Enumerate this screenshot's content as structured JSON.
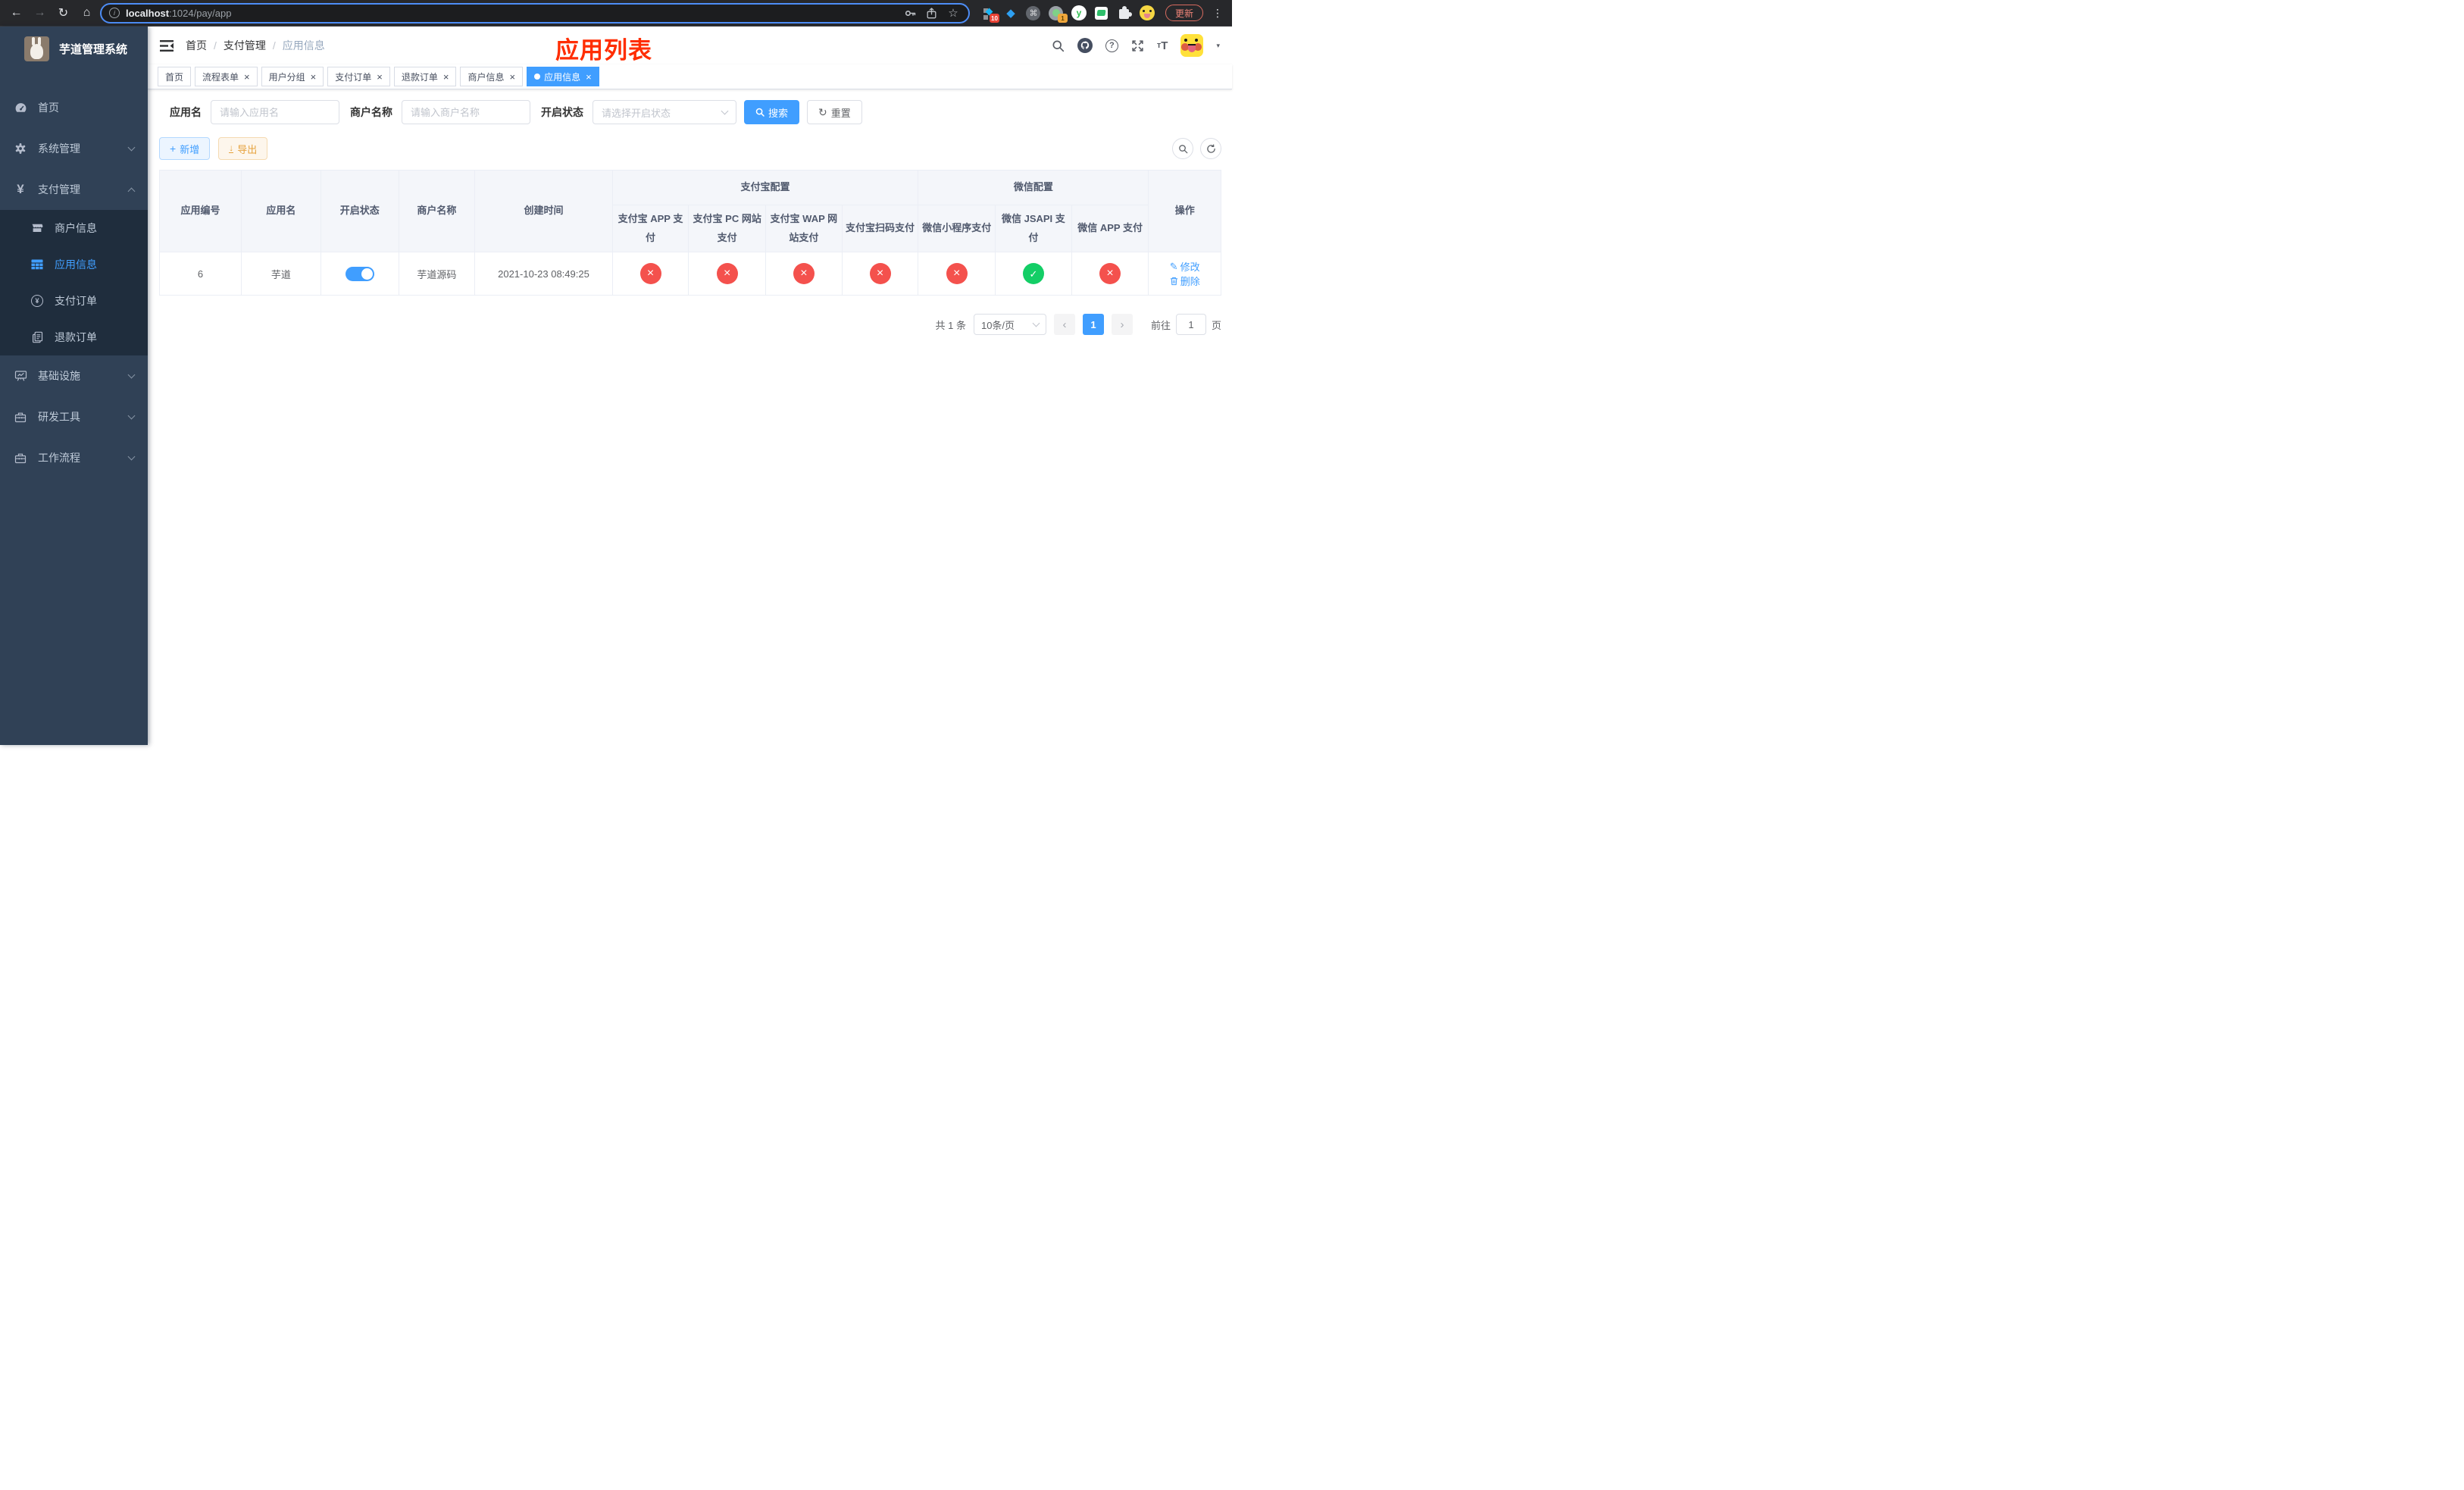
{
  "browser": {
    "url_host": "localhost",
    "url_path": ":1024/pay/app",
    "update_label": "更新",
    "ext_badge_blocks": "10",
    "ext_badge_avatar": "1"
  },
  "icons": {
    "back": "←",
    "forward": "→",
    "reload": "↻",
    "home": "⌂",
    "star": "☆",
    "dots": "⋮",
    "gem": "◆",
    "caret": "▾",
    "plus": "+",
    "download": "↓",
    "pencil": "✎",
    "prev": "‹",
    "next": "›",
    "reset": "↻"
  },
  "sidebar": {
    "title": "芋道管理系统",
    "items": {
      "home": "首页",
      "system": "系统管理",
      "pay": "支付管理",
      "merchant": "商户信息",
      "app": "应用信息",
      "pay_order": "支付订单",
      "refund_order": "退款订单",
      "infra": "基础设施",
      "dev_tools": "研发工具",
      "workflow": "工作流程"
    }
  },
  "header": {
    "breadcrumb": [
      "首页",
      "支付管理",
      "应用信息"
    ],
    "annotation": "应用列表"
  },
  "tabs": [
    {
      "label": "首页"
    },
    {
      "label": "流程表单"
    },
    {
      "label": "用户分组"
    },
    {
      "label": "支付订单"
    },
    {
      "label": "退款订单"
    },
    {
      "label": "商户信息"
    },
    {
      "label": "应用信息"
    }
  ],
  "filters": {
    "app_name_label": "应用名",
    "app_name_placeholder": "请输入应用名",
    "merchant_label": "商户名称",
    "merchant_placeholder": "请输入商户名称",
    "status_label": "开启状态",
    "status_placeholder": "请选择开启状态",
    "search_label": "搜索",
    "reset_label": "重置"
  },
  "toolbar": {
    "add_label": "新增",
    "export_label": "导出"
  },
  "table": {
    "group_alipay": "支付宝配置",
    "group_wechat": "微信配置",
    "columns": {
      "id": "应用编号",
      "name": "应用名",
      "status": "开启状态",
      "merchant": "商户名称",
      "created": "创建时间",
      "alipay_app": "支付宝 APP 支付",
      "alipay_pc": "支付宝 PC 网站支付",
      "alipay_wap": "支付宝 WAP 网站支付",
      "alipay_qr": "支付宝扫码支付",
      "wx_lite": "微信小程序支付",
      "wx_jsapi": "微信 JSAPI 支付",
      "wx_app": "微信 APP 支付",
      "actions": "操作"
    },
    "rows": [
      {
        "id": "6",
        "name": "芋道",
        "status_state": "on",
        "merchant": "芋道源码",
        "created": "2021-10-23 08:49:25",
        "channels": [
          "fail",
          "fail",
          "fail",
          "fail",
          "fail",
          "success",
          "fail"
        ],
        "edit_label": "修改",
        "delete_label": "删除"
      }
    ]
  },
  "pagination": {
    "total": "共 1 条",
    "page_size": "10条/页",
    "current_page": "1",
    "goto_label": "前往",
    "goto_value": "1",
    "page_unit": "页"
  }
}
